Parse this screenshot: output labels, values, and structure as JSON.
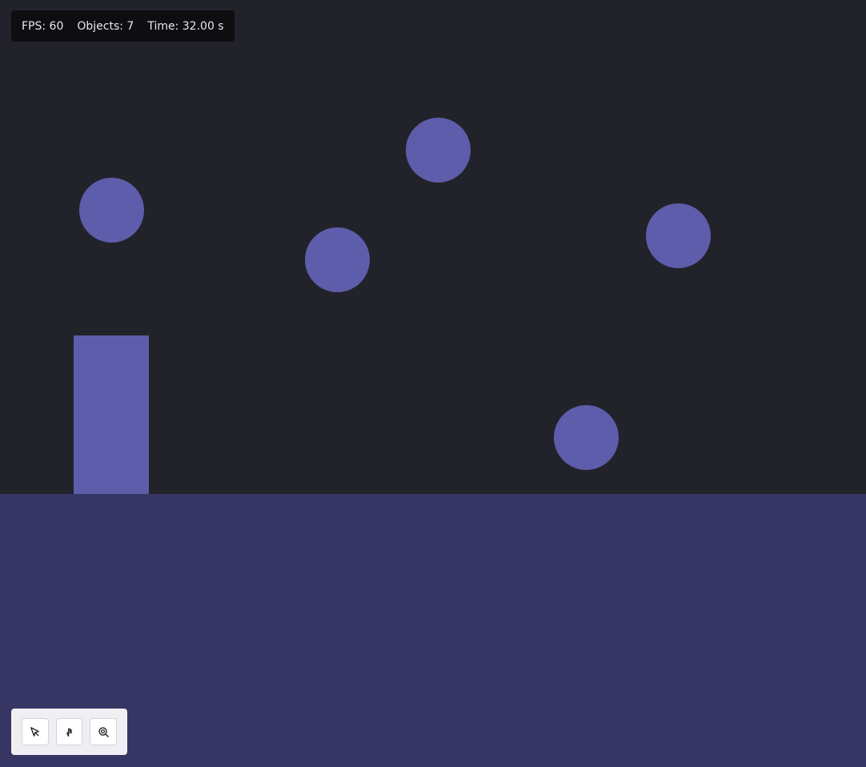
{
  "hud": {
    "fps": "FPS: 60",
    "objects": "Objects: 7",
    "time": "Time: 32.00 s"
  },
  "scene": {
    "background_color": "#22222b",
    "ground_color": "#363563",
    "body_color": "#5e5dab"
  },
  "toolbar": {
    "tools": [
      {
        "icon": "select-pointer-icon"
      },
      {
        "icon": "grab-hand-icon"
      },
      {
        "icon": "zoom-icon"
      }
    ]
  }
}
